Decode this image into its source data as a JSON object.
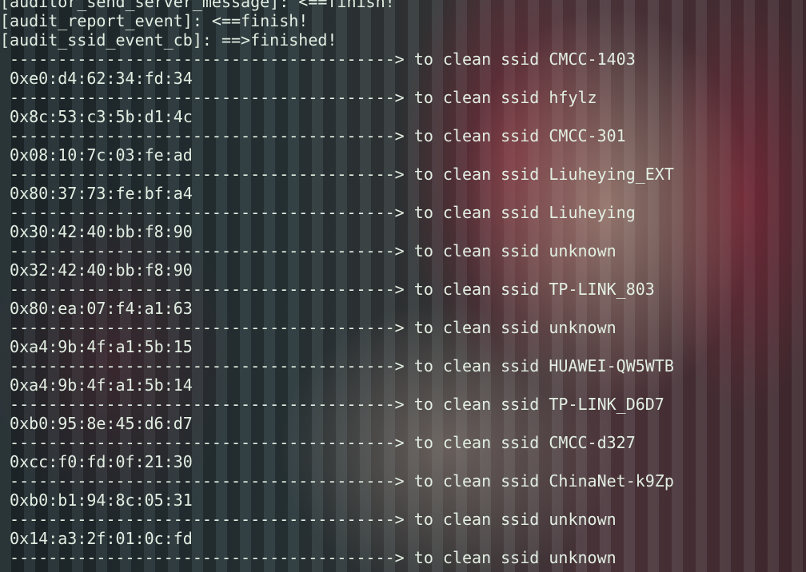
{
  "terminal": {
    "header_lines": [
      "[auditor_send_server_message]: <==finish!",
      "[audit_report_event]: <==finish!",
      "[audit_ssid_event_cb]: ==>finished!"
    ],
    "arrow": " ---------------------------------------->",
    "clean_prefix": " to clean ssid ",
    "entries": [
      {
        "ssid": "CMCC-1403",
        "mac": " 0xe0:d4:62:34:fd:34"
      },
      {
        "ssid": "hfylz",
        "mac": " 0x8c:53:c3:5b:d1:4c"
      },
      {
        "ssid": "CMCC-301",
        "mac": " 0x08:10:7c:03:fe:ad"
      },
      {
        "ssid": "Liuheying_EXT",
        "mac": " 0x80:37:73:fe:bf:a4"
      },
      {
        "ssid": "Liuheying",
        "mac": " 0x30:42:40:bb:f8:90"
      },
      {
        "ssid": "unknown",
        "mac": " 0x32:42:40:bb:f8:90"
      },
      {
        "ssid": "TP-LINK_803",
        "mac": " 0x80:ea:07:f4:a1:63"
      },
      {
        "ssid": "unknown",
        "mac": " 0xa4:9b:4f:a1:5b:15"
      },
      {
        "ssid": "HUAWEI-QW5WTB",
        "mac": " 0xa4:9b:4f:a1:5b:14"
      },
      {
        "ssid": "TP-LINK_D6D7",
        "mac": " 0xb0:95:8e:45:d6:d7"
      },
      {
        "ssid": "CMCC-d327",
        "mac": " 0xcc:f0:fd:0f:21:30"
      },
      {
        "ssid": "ChinaNet-k9Zp",
        "mac": " 0xb0:b1:94:8c:05:31"
      },
      {
        "ssid": "unknown",
        "mac": " 0x14:a3:2f:01:0c:fd"
      },
      {
        "ssid": "unknown",
        "mac": null
      }
    ]
  }
}
